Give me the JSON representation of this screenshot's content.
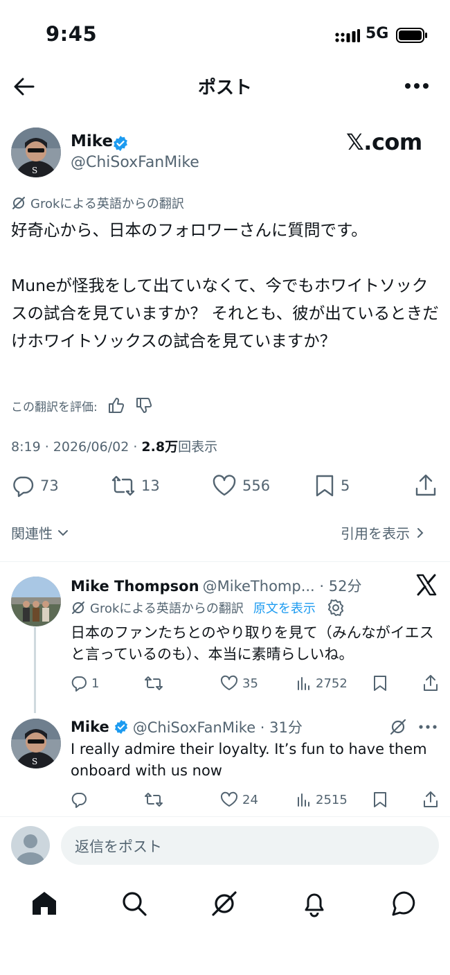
{
  "status": {
    "time": "9:45",
    "network": "5G"
  },
  "header": {
    "title": "ポスト"
  },
  "post": {
    "author_name": "Mike",
    "author_handle": "@ChiSoxFanMike",
    "watermark": "𝕏.com",
    "translation_note": "Grokによる英語からの翻訳",
    "text": "好奇心から、日本のフォロワーさんに質問です。\n\nMuneが怪我をして出ていなくて、今でもホワイトソックスの試合を見ていますか？ それとも、彼が出ているときだけホワイトソックスの試合を見ていますか？",
    "rate_label": "この翻訳を評価:",
    "time": "8:19 · 2026/06/02 · ",
    "views_count": "2.8万",
    "views_label": "回表示",
    "replies": "73",
    "reposts": "13",
    "likes": "556",
    "bookmarks": "5"
  },
  "relevance": {
    "label": "関連性",
    "quotes_label": "引用を表示"
  },
  "replies": [
    {
      "name": "Mike Thompson",
      "handle": "@MikeThomp... · 52分",
      "translation_note": "Grokによる英語からの翻訳",
      "show_original": "原文を表示",
      "text": "日本のファンたちとのやり取りを見て（みんながイエスと言っているのも）、本当に素晴らしいね。",
      "replies": "1",
      "reposts": "",
      "likes": "35",
      "views": "2752"
    },
    {
      "name": "Mike",
      "handle": "@ChiSoxFanMike · 31分",
      "text": "I really admire their loyalty. It’s fun to have them onboard with us now",
      "replies": "",
      "reposts": "",
      "likes": "24",
      "views": "2515"
    }
  ],
  "composer": {
    "placeholder": "返信をポスト"
  },
  "tabs": [
    "home-icon",
    "search-icon",
    "grok-icon",
    "notifications-icon",
    "messages-icon"
  ],
  "colors": {
    "accent": "#1d9bf0",
    "text": "#0f1419",
    "secondary": "#536471"
  }
}
